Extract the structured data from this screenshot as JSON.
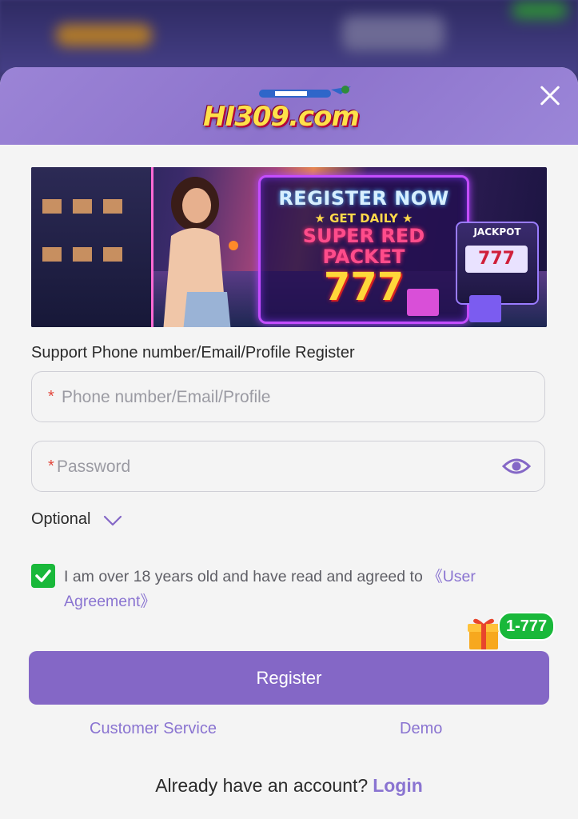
{
  "header": {
    "logo_text": "HI309.com",
    "close_icon": "close-icon"
  },
  "banner": {
    "line1": "REGISTER NOW",
    "line2": "★ GET DAILY ★",
    "line3": "SUPER RED",
    "line4": "PACKET",
    "line5": "777",
    "slot_label": "JACKPOT",
    "slot_reels": "777"
  },
  "form": {
    "support_label": "Support Phone number/Email/Profile Register",
    "account_required_mark": "*",
    "account_placeholder": "Phone number/Email/Profile",
    "password_required_mark": "*",
    "password_placeholder": "Password",
    "password_toggle_icon": "eye-icon",
    "optional_label": "Optional",
    "optional_icon": "chevron-down-icon",
    "agreement_checked": true,
    "agreement_text": "I am over 18 years old and have read and agreed to ",
    "agreement_link": "《User Agreement》",
    "promo_badge": "1-777",
    "register_label": "Register",
    "customer_service_label": "Customer Service",
    "demo_label": "Demo",
    "already_text": "Already have an account?",
    "login_label": "Login"
  },
  "colors": {
    "accent": "#8467c6",
    "link": "#8a74d1",
    "success": "#19b83a",
    "required": "#e2453a"
  }
}
